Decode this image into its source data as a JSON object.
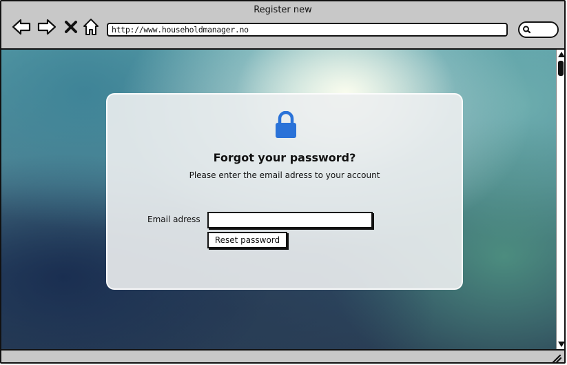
{
  "window": {
    "title": "Register new"
  },
  "toolbar": {
    "back_icon": "arrow-left-icon",
    "forward_icon": "arrow-right-icon",
    "close_icon": "x-icon",
    "home_icon": "home-icon",
    "address": "http://www.householdmanager.no",
    "search_icon": "search-icon"
  },
  "page": {
    "icon": "lock-icon",
    "heading": "Forgot your password?",
    "subtitle": "Please enter the email adress to your account",
    "email_label": "Email adress",
    "email_value": "",
    "reset_button": "Reset password"
  },
  "colors": {
    "accent": "#2a72d8",
    "card": "#eceef0",
    "chrome": "#c8c8c8"
  }
}
